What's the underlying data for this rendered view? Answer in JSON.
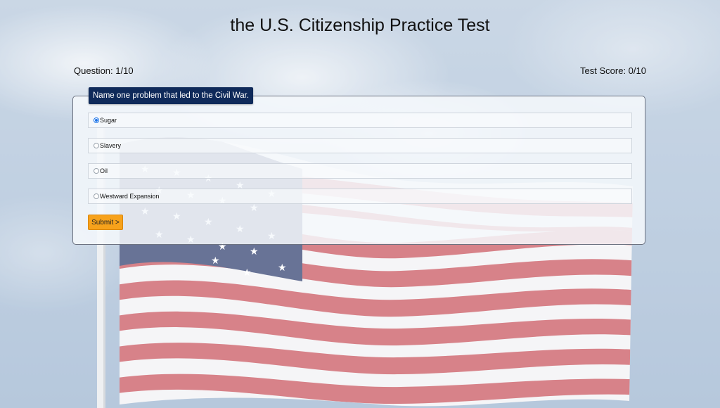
{
  "header": {
    "title": "the U.S. Citizenship Practice Test",
    "question_counter": "Question: 1/10",
    "score": "Test Score: 0/10"
  },
  "quiz": {
    "question": "Name one problem that led to the Civil War.",
    "options": [
      {
        "label": "Sugar",
        "selected": true
      },
      {
        "label": "Slavery",
        "selected": false
      },
      {
        "label": "Oil",
        "selected": false
      },
      {
        "label": "Westward Expansion",
        "selected": false
      }
    ],
    "submit_label": "Submit >"
  },
  "colors": {
    "question_bg": "#0f2a5a",
    "submit_bg": "#f7a21b",
    "radio_selected": "#1a73e8"
  }
}
